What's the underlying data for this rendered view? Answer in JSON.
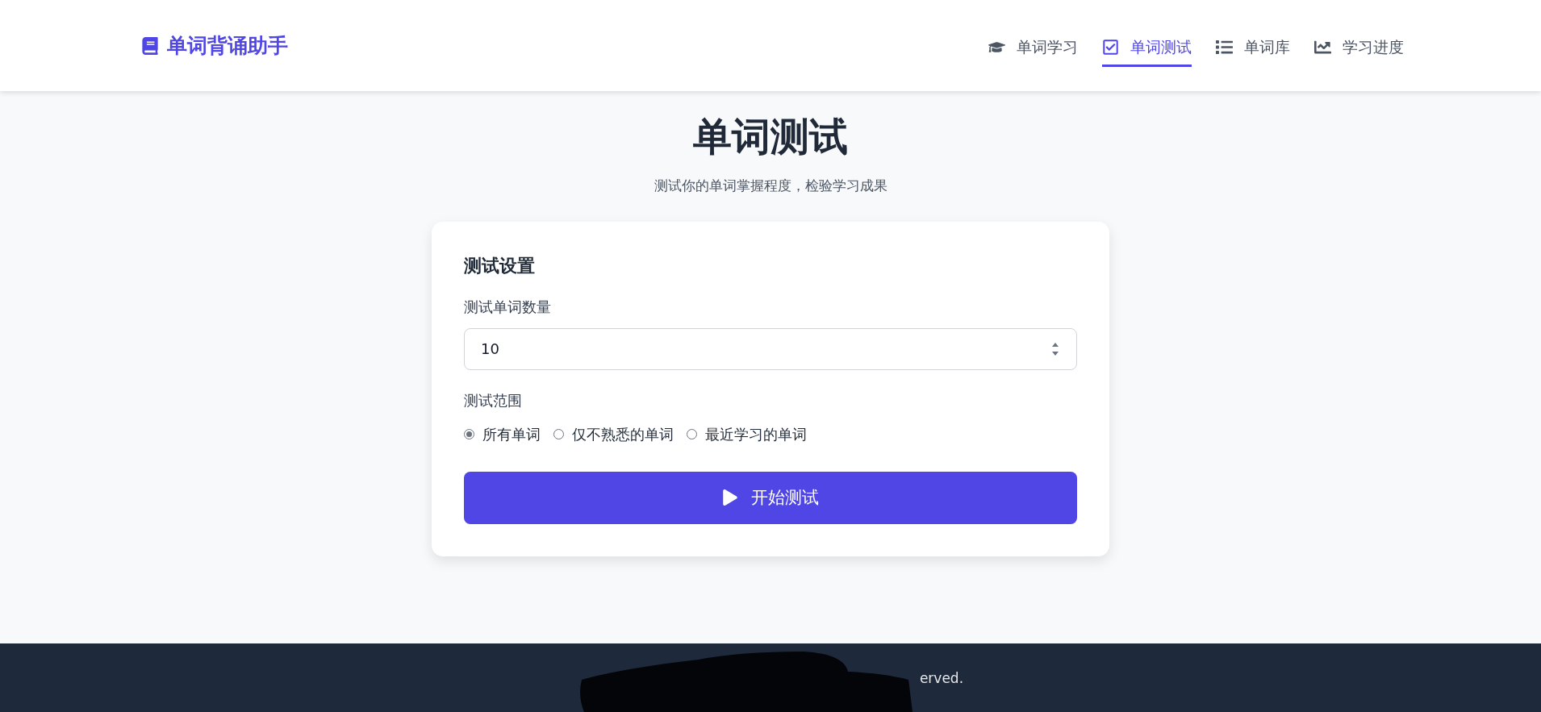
{
  "header": {
    "logo": "单词背诵助手",
    "nav": [
      {
        "label": "单词学习",
        "selected": false
      },
      {
        "label": "单词测试",
        "selected": true
      },
      {
        "label": "单词库",
        "selected": false
      },
      {
        "label": "学习进度",
        "selected": false
      }
    ]
  },
  "page": {
    "title": "单词测试",
    "subtitle": "测试你的单词掌握程度，检验学习成果"
  },
  "settings": {
    "title": "测试设置",
    "count_label": "测试单词数量",
    "count_value": "10",
    "scope_label": "测试范围",
    "scope_options": [
      {
        "label": "所有单词",
        "selected": true
      },
      {
        "label": "仅不熟悉的单词",
        "selected": false
      },
      {
        "label": "最近学习的单词",
        "selected": false
      }
    ],
    "start_button": "开始测试"
  },
  "footer": {
    "text": "erved."
  }
}
